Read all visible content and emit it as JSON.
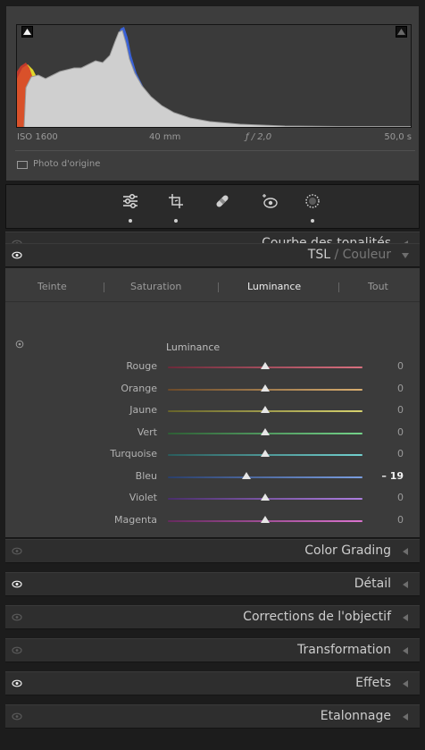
{
  "histogram": {
    "exif": {
      "iso": "ISO 1600",
      "focal": "40 mm",
      "aperture": "ƒ / 2,0",
      "shutter": "50,0 s"
    },
    "original_photo_label": "Photo d'origine"
  },
  "tools": [
    {
      "name": "edit",
      "active": true
    },
    {
      "name": "crop",
      "active": true
    },
    {
      "name": "heal",
      "active": false
    },
    {
      "name": "red-eye",
      "active": false
    },
    {
      "name": "masking",
      "active": true
    }
  ],
  "sections": {
    "tone_curve": "Courbe des tonalités",
    "tsl": {
      "title": "TSL",
      "separator": " / ",
      "subtitle": "Couleur"
    },
    "color_grading": "Color Grading",
    "detail": "Détail",
    "lens_corrections": "Corrections de l'objectif",
    "transformation": "Transformation",
    "effects": "Effets",
    "calibration": "Etalonnage"
  },
  "tsl": {
    "tabs": [
      "Teinte",
      "Saturation",
      "Luminance",
      "Tout"
    ],
    "active_tab": "Luminance",
    "heading": "Luminance",
    "sliders": [
      {
        "label": "Rouge",
        "value": "0",
        "norm": 0.0,
        "color_from": "#6b2a3a",
        "color_to": "#d9707f"
      },
      {
        "label": "Orange",
        "value": "0",
        "norm": 0.0,
        "color_from": "#6b4a2a",
        "color_to": "#d9ae70"
      },
      {
        "label": "Jaune",
        "value": "0",
        "norm": 0.0,
        "color_from": "#66632a",
        "color_to": "#d7d36f"
      },
      {
        "label": "Vert",
        "value": "0",
        "norm": 0.0,
        "color_from": "#2e5e35",
        "color_to": "#74d38a"
      },
      {
        "label": "Turquoise",
        "value": "0",
        "norm": 0.0,
        "color_from": "#2a5c5c",
        "color_to": "#72d1cf"
      },
      {
        "label": "Bleu",
        "value": "– 19",
        "norm": -0.19,
        "color_from": "#2a3f6b",
        "color_to": "#7a9ee0"
      },
      {
        "label": "Violet",
        "value": "0",
        "norm": 0.0,
        "color_from": "#4a2e6b",
        "color_to": "#ad7ee0"
      },
      {
        "label": "Magenta",
        "value": "0",
        "norm": 0.0,
        "color_from": "#662a5e",
        "color_to": "#db74cf"
      }
    ]
  }
}
